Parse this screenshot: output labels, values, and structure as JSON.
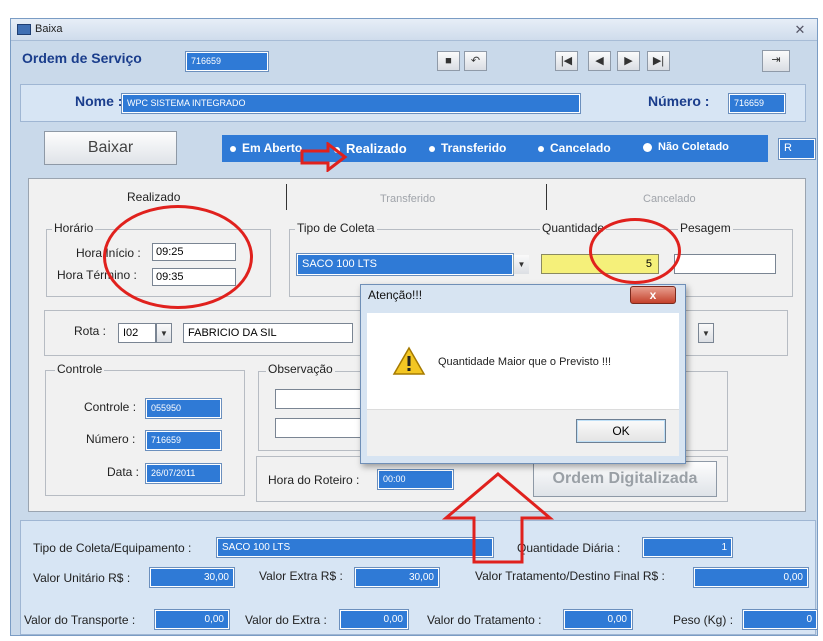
{
  "window": {
    "title": "Baixa"
  },
  "header": {
    "ordem_label": "Ordem de Serviço",
    "ordem_value": "716659",
    "nome_label": "Nome :",
    "nome_value": "WPC SISTEMA INTEGRADO",
    "numero_label": "Número :",
    "numero_value": "716659"
  },
  "toolbar": {
    "save_icon": "floppy-icon",
    "undo_icon": "undo-icon",
    "nav": [
      "|◀",
      "◀",
      "▶",
      "▶|"
    ],
    "exit_icon": "exit-icon"
  },
  "actions": {
    "baixar_label": "Baixar"
  },
  "status_options": [
    {
      "label": "Em Aberto",
      "selected": false
    },
    {
      "label": "Realizado",
      "selected": true
    },
    {
      "label": "Transferido",
      "selected": false
    },
    {
      "label": "Cancelado",
      "selected": false
    },
    {
      "label": "Não Coletado",
      "selected": false
    }
  ],
  "status_code": "R",
  "tabs": [
    "Realizado",
    "Transferido",
    "Cancelado"
  ],
  "horario": {
    "group_label": "Horário",
    "inicio_label": "Hora Início :",
    "inicio_value": "09:25",
    "termino_label": "Hora Término :",
    "termino_value": "09:35"
  },
  "coleta": {
    "group_label": "Tipo de Coleta",
    "value": "SACO 100 LTS",
    "quantidade_label": "Quantidade",
    "quantidade_value": "5",
    "pesagem_label": "Pesagem"
  },
  "rota": {
    "label": "Rota :",
    "code": "I02",
    "driver": "FABRICIO DA SIL"
  },
  "controle": {
    "group_label": "Controle",
    "controle_label": "Controle :",
    "controle_value": "055950",
    "numero_label": "Número :",
    "numero_value": "716659",
    "data_label": "Data :",
    "data_value": "26/07/2011"
  },
  "observacao": {
    "group_label": "Observação"
  },
  "roteiro": {
    "hora_label": "Hora do Roteiro :",
    "hora_value": "00:00",
    "digitalizada_label": "Ordem Digitalizada"
  },
  "bottom": {
    "tipo_label": "Tipo de Coleta/Equipamento :",
    "tipo_value": "SACO 100 LTS",
    "qtd_diaria_label": "Quantidade Diária :",
    "qtd_diaria_value": "1",
    "valor_unitario_label": "Valor Unitário R$ :",
    "valor_unitario_value": "30,00",
    "valor_extra_label": "Valor Extra R$ :",
    "valor_extra_value": "30,00",
    "valor_tratamento_final_label": "Valor Tratamento/Destino Final R$ :",
    "valor_tratamento_final_value": "0,00",
    "valor_transporte_label": "Valor do Transporte :",
    "valor_transporte_value": "0,00",
    "valor_do_extra_label": "Valor do Extra :",
    "valor_do_extra_value": "0,00",
    "valor_do_tratamento_label": "Valor do Tratamento :",
    "valor_do_tratamento_value": "0,00",
    "peso_label": "Peso (Kg) :",
    "peso_value": "0"
  },
  "dialog": {
    "title": "Atenção!!!",
    "close": "x",
    "message": "Quantidade Maior que o Previsto !!!",
    "ok_label": "OK",
    "icon": "warning-icon"
  },
  "colors": {
    "accent_blue": "#2f7ad6",
    "annotation_red": "#e0211d",
    "highlight_yellow": "#f5f07a"
  }
}
